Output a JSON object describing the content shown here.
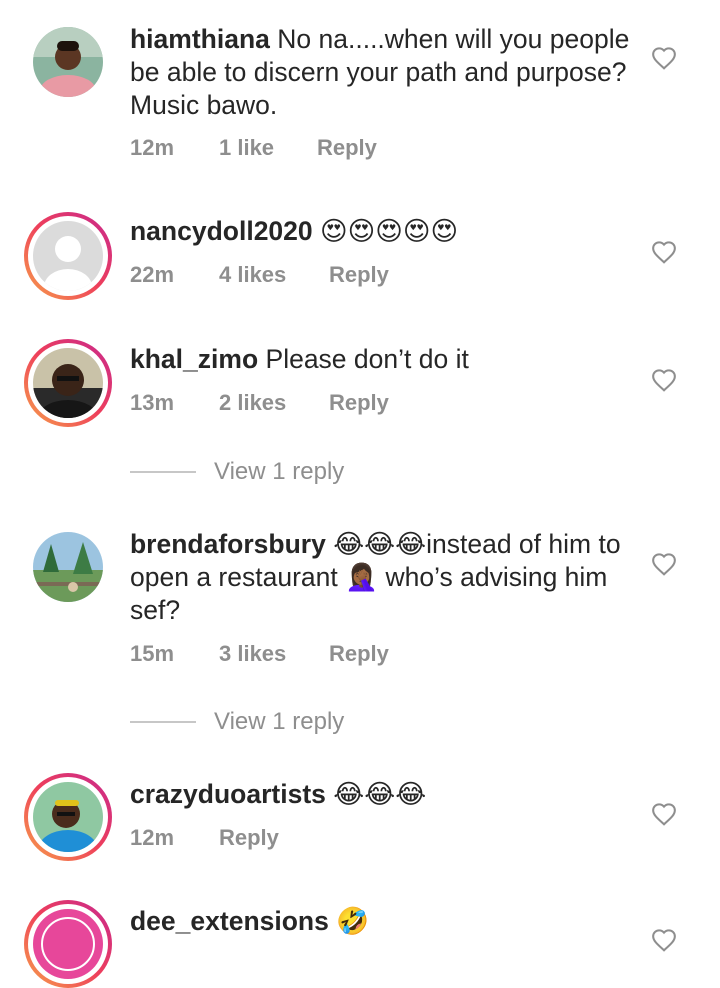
{
  "comments": [
    {
      "username": "hiamthiana",
      "body": "No na.....when will you people be able to discern your path and purpose? Music bawo.",
      "time": "12m",
      "likes": "1 like",
      "reply": "Reply"
    },
    {
      "username": "nancydoll2020",
      "body": "😍😍😍😍😍",
      "time": "22m",
      "likes": "4 likes",
      "reply": "Reply"
    },
    {
      "username": "khal_zimo",
      "body": "Please don’t do it",
      "time": "13m",
      "likes": "2 likes",
      "reply": "Reply",
      "view_replies": "View 1 reply"
    },
    {
      "username": "brendaforsbury",
      "body_part1": "😂😂😂instead of him to open a restaurant ",
      "body_emoji": "🤦🏾‍♀️",
      "body_part2": " who’s advising him sef?",
      "time": "15m",
      "likes": "3 likes",
      "reply": "Reply",
      "view_replies": "View 1 reply"
    },
    {
      "username": "crazyduoartists",
      "body": "😂😂😂",
      "time": "12m",
      "reply": "Reply"
    },
    {
      "username": "dee_extensions",
      "body": "🤣"
    }
  ],
  "icons": {
    "like": "heart-outline-icon"
  },
  "colors": {
    "story_ring_start": "#f7a34a",
    "story_ring_end": "#c7288f",
    "meta_text": "#8e8e8e"
  }
}
